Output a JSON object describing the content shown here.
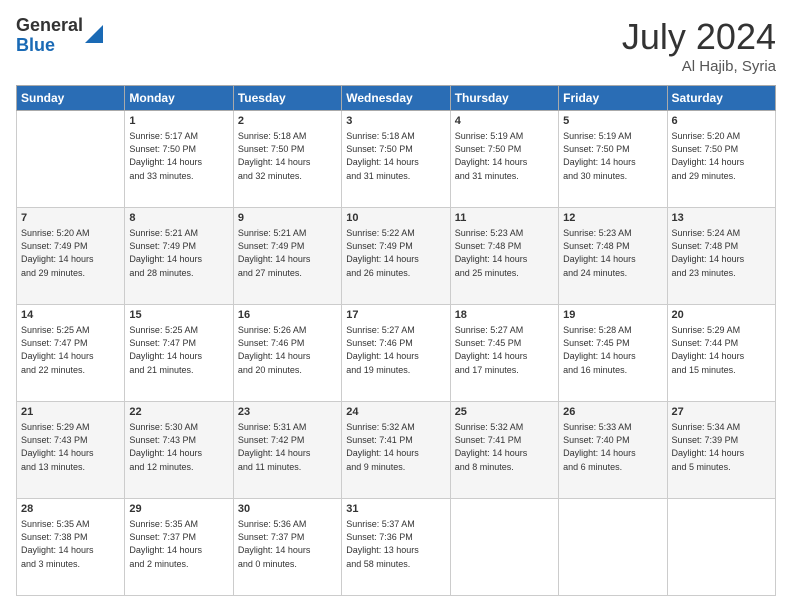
{
  "logo": {
    "general": "General",
    "blue": "Blue"
  },
  "title": {
    "month_year": "July 2024",
    "location": "Al Hajib, Syria"
  },
  "headers": [
    "Sunday",
    "Monday",
    "Tuesday",
    "Wednesday",
    "Thursday",
    "Friday",
    "Saturday"
  ],
  "weeks": [
    [
      {
        "day": "",
        "content": ""
      },
      {
        "day": "1",
        "content": "Sunrise: 5:17 AM\nSunset: 7:50 PM\nDaylight: 14 hours\nand 33 minutes."
      },
      {
        "day": "2",
        "content": "Sunrise: 5:18 AM\nSunset: 7:50 PM\nDaylight: 14 hours\nand 32 minutes."
      },
      {
        "day": "3",
        "content": "Sunrise: 5:18 AM\nSunset: 7:50 PM\nDaylight: 14 hours\nand 31 minutes."
      },
      {
        "day": "4",
        "content": "Sunrise: 5:19 AM\nSunset: 7:50 PM\nDaylight: 14 hours\nand 31 minutes."
      },
      {
        "day": "5",
        "content": "Sunrise: 5:19 AM\nSunset: 7:50 PM\nDaylight: 14 hours\nand 30 minutes."
      },
      {
        "day": "6",
        "content": "Sunrise: 5:20 AM\nSunset: 7:50 PM\nDaylight: 14 hours\nand 29 minutes."
      }
    ],
    [
      {
        "day": "7",
        "content": ""
      },
      {
        "day": "8",
        "content": "Sunrise: 5:21 AM\nSunset: 7:49 PM\nDaylight: 14 hours\nand 28 minutes."
      },
      {
        "day": "9",
        "content": "Sunrise: 5:21 AM\nSunset: 7:49 PM\nDaylight: 14 hours\nand 27 minutes."
      },
      {
        "day": "10",
        "content": "Sunrise: 5:22 AM\nSunset: 7:49 PM\nDaylight: 14 hours\nand 26 minutes."
      },
      {
        "day": "11",
        "content": "Sunrise: 5:23 AM\nSunset: 7:48 PM\nDaylight: 14 hours\nand 25 minutes."
      },
      {
        "day": "12",
        "content": "Sunrise: 5:23 AM\nSunset: 7:48 PM\nDaylight: 14 hours\nand 24 minutes."
      },
      {
        "day": "13",
        "content": "Sunrise: 5:24 AM\nSunset: 7:48 PM\nDaylight: 14 hours\nand 23 minutes."
      }
    ],
    [
      {
        "day": "14",
        "content": ""
      },
      {
        "day": "15",
        "content": "Sunrise: 5:25 AM\nSunset: 7:47 PM\nDaylight: 14 hours\nand 21 minutes."
      },
      {
        "day": "16",
        "content": "Sunrise: 5:26 AM\nSunset: 7:46 PM\nDaylight: 14 hours\nand 20 minutes."
      },
      {
        "day": "17",
        "content": "Sunrise: 5:27 AM\nSunset: 7:46 PM\nDaylight: 14 hours\nand 19 minutes."
      },
      {
        "day": "18",
        "content": "Sunrise: 5:27 AM\nSunset: 7:45 PM\nDaylight: 14 hours\nand 17 minutes."
      },
      {
        "day": "19",
        "content": "Sunrise: 5:28 AM\nSunset: 7:45 PM\nDaylight: 14 hours\nand 16 minutes."
      },
      {
        "day": "20",
        "content": "Sunrise: 5:29 AM\nSunset: 7:44 PM\nDaylight: 14 hours\nand 15 minutes."
      }
    ],
    [
      {
        "day": "21",
        "content": ""
      },
      {
        "day": "22",
        "content": "Sunrise: 5:30 AM\nSunset: 7:43 PM\nDaylight: 14 hours\nand 12 minutes."
      },
      {
        "day": "23",
        "content": "Sunrise: 5:31 AM\nSunset: 7:42 PM\nDaylight: 14 hours\nand 11 minutes."
      },
      {
        "day": "24",
        "content": "Sunrise: 5:32 AM\nSunset: 7:41 PM\nDaylight: 14 hours\nand 9 minutes."
      },
      {
        "day": "25",
        "content": "Sunrise: 5:32 AM\nSunset: 7:41 PM\nDaylight: 14 hours\nand 8 minutes."
      },
      {
        "day": "26",
        "content": "Sunrise: 5:33 AM\nSunset: 7:40 PM\nDaylight: 14 hours\nand 6 minutes."
      },
      {
        "day": "27",
        "content": "Sunrise: 5:34 AM\nSunset: 7:39 PM\nDaylight: 14 hours\nand 5 minutes."
      }
    ],
    [
      {
        "day": "28",
        "content": "Sunrise: 5:35 AM\nSunset: 7:38 PM\nDaylight: 14 hours\nand 3 minutes."
      },
      {
        "day": "29",
        "content": "Sunrise: 5:35 AM\nSunset: 7:37 PM\nDaylight: 14 hours\nand 2 minutes."
      },
      {
        "day": "30",
        "content": "Sunrise: 5:36 AM\nSunset: 7:37 PM\nDaylight: 14 hours\nand 0 minutes."
      },
      {
        "day": "31",
        "content": "Sunrise: 5:37 AM\nSunset: 7:36 PM\nDaylight: 13 hours\nand 58 minutes."
      },
      {
        "day": "",
        "content": ""
      },
      {
        "day": "",
        "content": ""
      },
      {
        "day": "",
        "content": ""
      }
    ]
  ],
  "week7_sunday": "Sunrise: 5:20 AM\nSunset: 7:49 PM\nDaylight: 14 hours\nand 29 minutes.",
  "week14_sunday": "Sunrise: 5:25 AM\nSunset: 7:47 PM\nDaylight: 14 hours\nand 22 minutes.",
  "week21_sunday": "Sunrise: 5:29 AM\nSunset: 7:43 PM\nDaylight: 14 hours\nand 13 minutes."
}
